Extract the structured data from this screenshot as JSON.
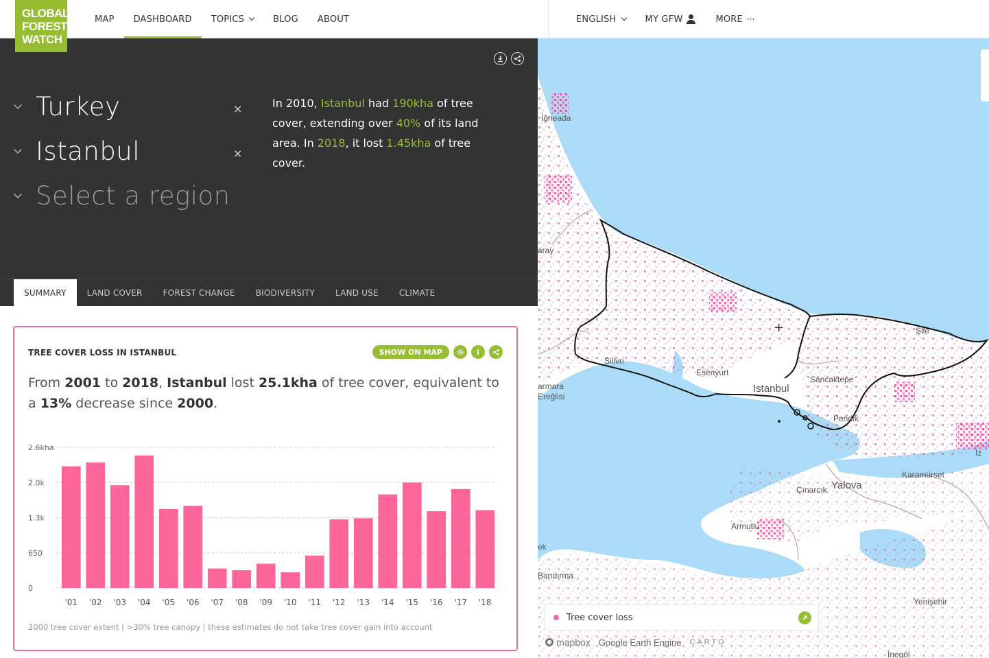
{
  "header": {
    "logo": [
      "GLOBAL",
      "FOREST",
      "WATCH"
    ],
    "nav": [
      {
        "label": "MAP"
      },
      {
        "label": "DASHBOARD"
      },
      {
        "label": "TOPICS"
      },
      {
        "label": "BLOG"
      },
      {
        "label": "ABOUT"
      }
    ],
    "nav_right": {
      "language": "ENGLISH",
      "my_gfw": "MY GFW",
      "more": "MORE",
      "more_dots": "···"
    }
  },
  "panel": {
    "locations": {
      "country": "Turkey",
      "region": "Istanbul",
      "subregion_placeholder": "Select a region"
    },
    "close_glyph": "×",
    "sentence": {
      "p1": "In 2010, ",
      "place": "Istanbul",
      "p2": " had ",
      "cover": "190kha",
      "p3": " of tree cover, extending over ",
      "percent": "40%",
      "p4": " of its land area. In ",
      "year": "2018",
      "p5": ", it lost ",
      "loss": "1.45kha",
      "p6": " of tree cover."
    },
    "tabs": [
      "SUMMARY",
      "LAND COVER",
      "FOREST CHANGE",
      "BIODIVERSITY",
      "LAND USE",
      "CLIMATE"
    ]
  },
  "widget": {
    "title": "TREE COVER LOSS IN ISTANBUL",
    "show_on_map": "SHOW ON MAP",
    "info_glyph": "i",
    "sentence": {
      "p1": "From ",
      "start": "2001",
      "p2": " to ",
      "end": "2018",
      "p3": ", ",
      "place": "Istanbul",
      "p4": " lost ",
      "loss": "25.1kha",
      "p5": " of tree cover, equivalent to a ",
      "percent": "13%",
      "p6": " decrease since ",
      "base": "2000",
      "p7": "."
    },
    "footnote": "2000 tree cover extent | >30% tree canopy | these estimates do not take tree cover gain into account"
  },
  "chart_data": {
    "type": "bar",
    "categories": [
      "'01",
      "'02",
      "'03",
      "'04",
      "'05",
      "'06",
      "'07",
      "'08",
      "'09",
      "'10",
      "'11",
      "'12",
      "'13",
      "'14",
      "'15",
      "'16",
      "'17",
      "'18"
    ],
    "values": [
      2250,
      2320,
      1900,
      2450,
      1460,
      1520,
      360,
      330,
      450,
      290,
      600,
      1270,
      1290,
      1730,
      1950,
      1420,
      1830,
      1440
    ],
    "y_ticks": [
      0,
      650,
      1300,
      1950,
      2600
    ],
    "y_tick_labels": [
      "0",
      "650",
      "1.3k",
      "2.0k",
      "2.6kha"
    ],
    "ylim": [
      0,
      2600
    ],
    "color": "#fe6598",
    "grid": true
  },
  "map": {
    "labels": [
      {
        "text": "İğneada"
      },
      {
        "text": "aray"
      },
      {
        "text": "Silivri"
      },
      {
        "text": "Esenyurt"
      },
      {
        "text": "Istanbul"
      },
      {
        "text": "Şile"
      },
      {
        "text": "Sancaktepe"
      },
      {
        "text": "Pendik"
      },
      {
        "text": "armara"
      },
      {
        "text": "Ereğlisi"
      },
      {
        "text": "Karamürsel"
      },
      {
        "text": "Çınarcık"
      },
      {
        "text": "Yalova"
      },
      {
        "text": "Armutlu"
      },
      {
        "text": "ek"
      },
      {
        "text": "Bandırma"
      },
      {
        "text": "Yenişehir"
      },
      {
        "text": "İz"
      },
      {
        "text": "İnegöl"
      }
    ],
    "crosshair": "+",
    "legend": {
      "label": "Tree cover loss",
      "color": "#ee6aa4"
    },
    "attribution": {
      "mapbox": "mapbox",
      "earth_engine": "Google Earth Engine",
      "carto": "CARTO"
    },
    "colors": {
      "water": "#aadbf7",
      "land": "#ffffff",
      "loss": "#e0378a"
    }
  }
}
